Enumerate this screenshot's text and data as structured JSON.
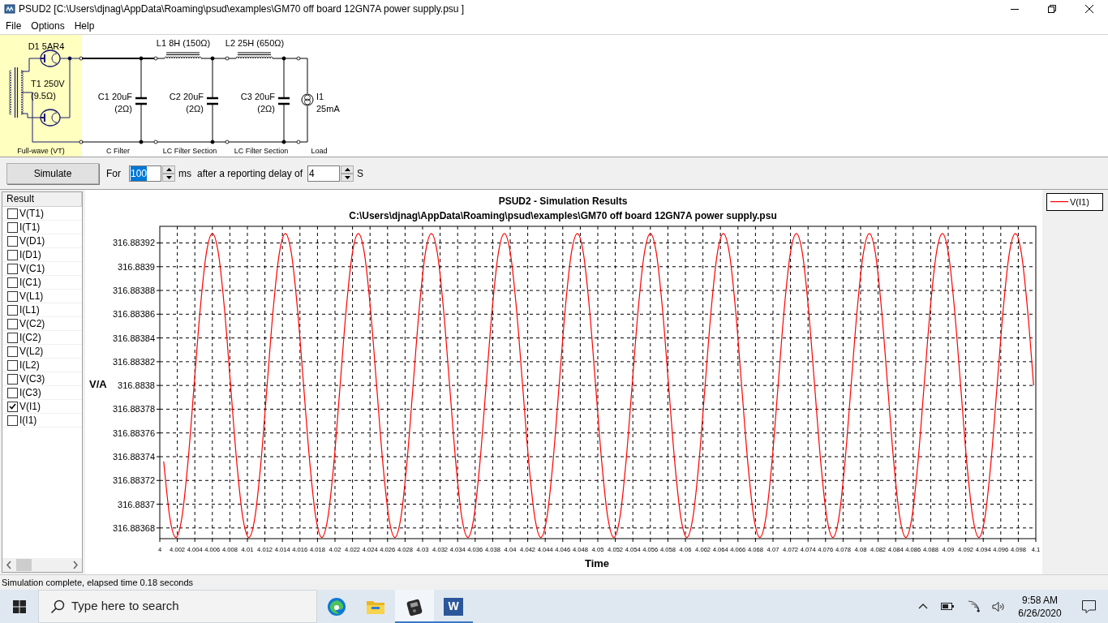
{
  "window": {
    "title": "PSUD2 [C:\\Users\\djnag\\AppData\\Roaming\\psud\\examples\\GM70 off board 12GN7A power supply.psu ]"
  },
  "menu": [
    "File",
    "Options",
    "Help"
  ],
  "schematic": {
    "sections": [
      {
        "kind": "rectifier",
        "label": "Full-wave (VT)",
        "selected": true,
        "lines": [
          "D1 5AR4",
          "T1 250V",
          "(9.5Ω)"
        ]
      },
      {
        "kind": "capacitor",
        "label": "C Filter",
        "selected": false,
        "lines": [
          "C1 20uF",
          "(2Ω)"
        ]
      },
      {
        "kind": "lc",
        "label": "LC Filter Section",
        "selected": false,
        "inductor": "L1 8H (150Ω)",
        "lines": [
          "C2 20uF",
          "(2Ω)"
        ]
      },
      {
        "kind": "lc",
        "label": "LC Filter Section",
        "selected": false,
        "inductor": "L2 25H (650Ω)",
        "lines": [
          "C3 20uF",
          "(2Ω)"
        ]
      },
      {
        "kind": "load",
        "label": "Load",
        "selected": false,
        "lines": [
          "I1",
          "25mA"
        ]
      }
    ]
  },
  "toolbar": {
    "simulate_button": "Simulate",
    "for_label": "For",
    "duration": {
      "value": "100",
      "highlighted": true
    },
    "duration_unit": "ms",
    "delay_label": "after a reporting delay of",
    "delay": {
      "value": "4",
      "highlighted": false
    },
    "delay_unit": "S"
  },
  "results": {
    "header": "Result",
    "items": [
      {
        "label": "V(T1)",
        "checked": false
      },
      {
        "label": "I(T1)",
        "checked": false
      },
      {
        "label": "V(D1)",
        "checked": false
      },
      {
        "label": "I(D1)",
        "checked": false
      },
      {
        "label": "V(C1)",
        "checked": false
      },
      {
        "label": "I(C1)",
        "checked": false
      },
      {
        "label": "V(L1)",
        "checked": false
      },
      {
        "label": "I(L1)",
        "checked": false
      },
      {
        "label": "V(C2)",
        "checked": false
      },
      {
        "label": "I(C2)",
        "checked": false
      },
      {
        "label": "V(L2)",
        "checked": false
      },
      {
        "label": "I(L2)",
        "checked": false
      },
      {
        "label": "V(C3)",
        "checked": false
      },
      {
        "label": "I(C3)",
        "checked": false
      },
      {
        "label": "V(I1)",
        "checked": true
      },
      {
        "label": "I(I1)",
        "checked": false
      }
    ]
  },
  "chart": {
    "subtitle": "C:\\Users\\djnag\\AppData\\Roaming\\psud\\examples\\GM70 off board 12GN7A power supply.psu",
    "chart_data": {
      "type": "line",
      "grid": true,
      "title": "PSUD2 - Simulation Results",
      "xlabel": "Time",
      "ylabel": "V/A",
      "xlim": [
        4,
        4.1
      ],
      "ylim": [
        316.883671,
        316.883934
      ],
      "xticks": [
        4,
        4.002,
        4.004,
        4.006,
        4.008,
        4.01,
        4.012,
        4.014,
        4.016,
        4.018,
        4.02,
        4.022,
        4.024,
        4.026,
        4.028,
        4.03,
        4.032,
        4.034,
        4.036,
        4.038,
        4.04,
        4.042,
        4.044,
        4.046,
        4.048,
        4.05,
        4.052,
        4.054,
        4.056,
        4.058,
        4.06,
        4.062,
        4.064,
        4.066,
        4.068,
        4.07,
        4.072,
        4.074,
        4.076,
        4.078,
        4.08,
        4.082,
        4.084,
        4.086,
        4.088,
        4.09,
        4.092,
        4.094,
        4.096,
        4.098,
        4.1
      ],
      "yticks": [
        316.88368,
        316.8837,
        316.88372,
        316.88374,
        316.88376,
        316.88378,
        316.8838,
        316.88382,
        316.88384,
        316.88386,
        316.88388,
        316.8839,
        316.88392
      ],
      "x": [
        4.000444,
        4.001139,
        4.001833,
        4.002528,
        4.003222,
        4.003917,
        4.004611,
        4.005306,
        4.006,
        4.006694,
        4.007389,
        4.008083,
        4.008778,
        4.009472,
        4.010167,
        4.010861,
        4.011556,
        4.01225,
        4.012944,
        4.013639,
        4.014333,
        4.015028,
        4.015722,
        4.016417,
        4.017111,
        4.017806,
        4.0185,
        4.019194,
        4.019889,
        4.020583,
        4.021278,
        4.021972,
        4.022667,
        4.023361,
        4.024056,
        4.02475,
        4.025444,
        4.026139,
        4.026833,
        4.027528,
        4.028222,
        4.028917,
        4.029611,
        4.030306,
        4.031,
        4.031694,
        4.032389,
        4.033083,
        4.033778,
        4.034472,
        4.035167,
        4.035861,
        4.036556,
        4.03725,
        4.037944,
        4.038639,
        4.039333,
        4.040028,
        4.040722,
        4.041417,
        4.042111,
        4.042806,
        4.0435,
        4.044194,
        4.044889,
        4.045583,
        4.046278,
        4.046972,
        4.047667,
        4.048361,
        4.049056,
        4.04975,
        4.050444,
        4.051139,
        4.051833,
        4.052528,
        4.053222,
        4.053917,
        4.054611,
        4.055306,
        4.056,
        4.056694,
        4.057389,
        4.058083,
        4.058778,
        4.059472,
        4.060167,
        4.060861,
        4.061556,
        4.06225,
        4.062944,
        4.063639,
        4.064333,
        4.065028,
        4.065722,
        4.066417,
        4.067111,
        4.067806,
        4.0685,
        4.069194,
        4.069889,
        4.070583,
        4.071278,
        4.071972,
        4.072667,
        4.073361,
        4.074056,
        4.07475,
        4.075444,
        4.076139,
        4.076833,
        4.077528,
        4.078222,
        4.078917,
        4.079611,
        4.080306,
        4.081,
        4.081694,
        4.082389,
        4.083083,
        4.083778,
        4.084472,
        4.085167,
        4.085861,
        4.086556,
        4.08725,
        4.087944,
        4.088639,
        4.089333,
        4.090028,
        4.090722,
        4.091417,
        4.092111,
        4.092806,
        4.0935,
        4.094194,
        4.094889,
        4.095583,
        4.096278,
        4.096972,
        4.097667,
        4.098361,
        4.099056,
        4.09975
      ],
      "series": [
        {
          "name": "V(I1)",
          "color": "#ff0000",
          "values": [
            316.883736,
            316.883689,
            316.883672,
            316.883689,
            316.883736,
            316.8838,
            316.883864,
            316.883911,
            316.883928,
            316.883911,
            316.883864,
            316.8838,
            316.883736,
            316.883689,
            316.883672,
            316.883689,
            316.883736,
            316.8838,
            316.883864,
            316.883911,
            316.883928,
            316.883911,
            316.883864,
            316.8838,
            316.883736,
            316.883689,
            316.883672,
            316.883689,
            316.883736,
            316.8838,
            316.883864,
            316.883911,
            316.883928,
            316.883911,
            316.883864,
            316.8838,
            316.883736,
            316.883689,
            316.883672,
            316.883689,
            316.883736,
            316.8838,
            316.883864,
            316.883911,
            316.883928,
            316.883911,
            316.883864,
            316.8838,
            316.883736,
            316.883689,
            316.883672,
            316.883689,
            316.883736,
            316.8838,
            316.883864,
            316.883911,
            316.883928,
            316.883911,
            316.883864,
            316.8838,
            316.883736,
            316.883689,
            316.883672,
            316.883689,
            316.883736,
            316.8838,
            316.883864,
            316.883911,
            316.883928,
            316.883911,
            316.883864,
            316.8838,
            316.883736,
            316.883689,
            316.883672,
            316.883689,
            316.883736,
            316.8838,
            316.883864,
            316.883911,
            316.883928,
            316.883911,
            316.883864,
            316.8838,
            316.883736,
            316.883689,
            316.883672,
            316.883689,
            316.883736,
            316.8838,
            316.883864,
            316.883911,
            316.883928,
            316.883911,
            316.883864,
            316.8838,
            316.883736,
            316.883689,
            316.883672,
            316.883689,
            316.883736,
            316.8838,
            316.883864,
            316.883911,
            316.883928,
            316.883911,
            316.883864,
            316.8838,
            316.883736,
            316.883689,
            316.883672,
            316.883689,
            316.883736,
            316.8838,
            316.883864,
            316.883911,
            316.883928,
            316.883911,
            316.883864,
            316.8838,
            316.883736,
            316.883689,
            316.883672,
            316.883689,
            316.883736,
            316.8838,
            316.883864,
            316.883911,
            316.883928,
            316.883911,
            316.883864,
            316.8838,
            316.883736,
            316.883689,
            316.883672,
            316.883689,
            316.883736,
            316.8838,
            316.883864,
            316.883911,
            316.883928,
            316.883911,
            316.883864,
            316.8838
          ]
        }
      ]
    }
  },
  "status_bar": "Simulation complete, elapsed time 0.18 seconds",
  "taskbar": {
    "search": {
      "placeholder": "Type here to search"
    },
    "apps": [
      {
        "kind": "browser",
        "running": false,
        "selected": false
      },
      {
        "kind": "folder",
        "running": false,
        "selected": false
      },
      {
        "kind": "device",
        "running": true,
        "selected": true
      },
      {
        "kind": "document",
        "glyph": "W",
        "running": true,
        "selected": false
      }
    ],
    "time": "9:58 AM",
    "date": "6/26/2020"
  }
}
